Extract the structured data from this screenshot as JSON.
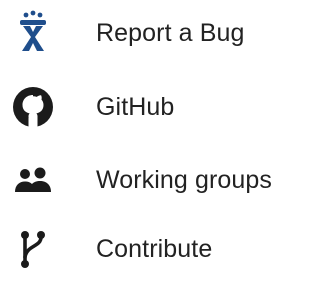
{
  "colors": {
    "text": "#222222",
    "bug_icon": "#1f4e8c",
    "icon_dark": "#1b1b1b"
  },
  "menu": {
    "items": [
      {
        "label": "Report a Bug",
        "icon": "bug-report-icon"
      },
      {
        "label": "GitHub",
        "icon": "github-icon"
      },
      {
        "label": "Working groups",
        "icon": "users-icon"
      },
      {
        "label": "Contribute",
        "icon": "branch-icon"
      }
    ]
  }
}
